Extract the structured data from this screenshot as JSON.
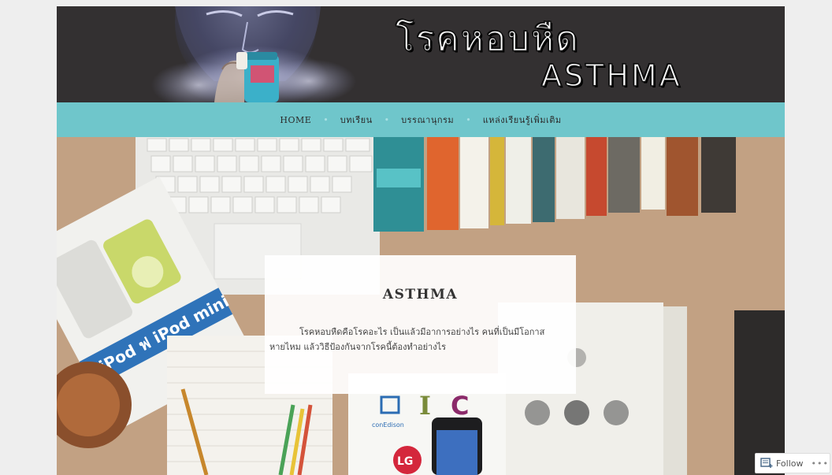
{
  "header": {
    "title_thai": "โรคหอบหืด",
    "title_en": "ASTHMA"
  },
  "nav": {
    "items": [
      {
        "label": "HOME"
      },
      {
        "label": "บทเรียน"
      },
      {
        "label": "บรรณานุกรม"
      },
      {
        "label": "แหล่งเรียนรู้เพิ่มเติม"
      }
    ]
  },
  "hero_card": {
    "title": "ASTHMA",
    "text": "โรคหอบหืดคือโรคอะไร เป็นแล้วมีอาการอย่างไร คนที่เป็นมีโอกาสหายไหม แล้ววิธีป้องกันจากโรคนี้ต้องทำอย่างไร"
  },
  "photo_labels": {
    "ipod_ad": "iPod ฟ iPod mini",
    "brand_conedison": "conEdison",
    "brand_lg": "LG"
  },
  "follow_widget": {
    "label": "Follow",
    "more": "•••"
  },
  "colors": {
    "banner_bg": "#333031",
    "nav_bg": "#6fc6cb",
    "page_bg": "#eeeeee"
  }
}
